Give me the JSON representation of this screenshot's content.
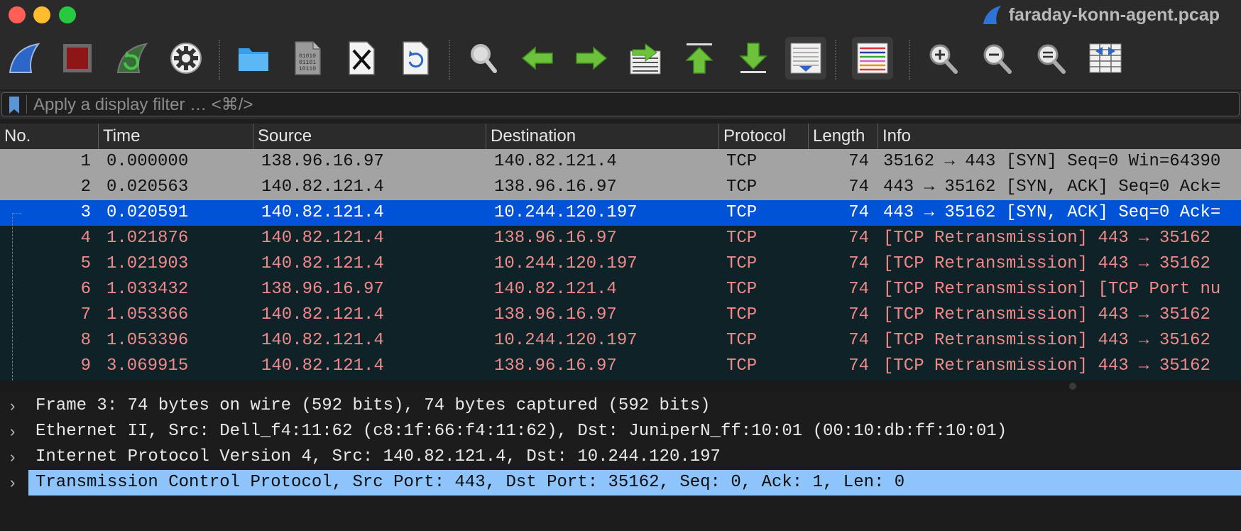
{
  "window": {
    "title": "faraday-konn-agent.pcap",
    "traffic_lights": {
      "close": "#ff5f57",
      "minimize": "#febc2e",
      "zoom": "#28c840"
    }
  },
  "toolbar": {
    "buttons": [
      {
        "name": "start-capture-button",
        "icon": "shark-fin-icon"
      },
      {
        "name": "stop-capture-button",
        "icon": "stop-square-icon"
      },
      {
        "name": "restart-capture-button",
        "icon": "restart-fin-icon"
      },
      {
        "name": "capture-options-button",
        "icon": "gear-icon"
      },
      {
        "name": "open-file-button",
        "icon": "folder-icon"
      },
      {
        "name": "save-file-button",
        "icon": "binary-file-icon"
      },
      {
        "name": "close-file-button",
        "icon": "close-file-icon"
      },
      {
        "name": "reload-file-button",
        "icon": "reload-file-icon"
      },
      {
        "name": "find-packet-button",
        "icon": "magnifier-icon"
      },
      {
        "name": "go-back-button",
        "icon": "arrow-left-icon"
      },
      {
        "name": "go-forward-button",
        "icon": "arrow-right-icon"
      },
      {
        "name": "go-to-packet-button",
        "icon": "goto-packet-icon"
      },
      {
        "name": "go-first-packet-button",
        "icon": "arrow-top-icon"
      },
      {
        "name": "go-last-packet-button",
        "icon": "arrow-bottom-icon"
      },
      {
        "name": "auto-scroll-button",
        "icon": "autoscroll-icon"
      },
      {
        "name": "colorize-button",
        "icon": "colorize-lines-icon"
      },
      {
        "name": "zoom-in-button",
        "icon": "zoom-in-icon"
      },
      {
        "name": "zoom-out-button",
        "icon": "zoom-out-icon"
      },
      {
        "name": "zoom-reset-button",
        "icon": "zoom-reset-icon"
      },
      {
        "name": "resize-columns-button",
        "icon": "resize-columns-icon"
      }
    ]
  },
  "filter": {
    "placeholder": "Apply a display filter … <⌘/>",
    "value": ""
  },
  "colors": {
    "selected_row_bg": "#0053d6",
    "gray_row_bg": "#a3a3a3",
    "dark_row_bg": "#0f2228",
    "error_text": "#f08a8a",
    "detail_selected_bg": "#8ec4fc"
  },
  "packet_list": {
    "columns": [
      "No.",
      "Time",
      "Source",
      "Destination",
      "Protocol",
      "Length",
      "Info"
    ],
    "rows": [
      {
        "no": "1",
        "time": "0.000000",
        "src": "138.96.16.97",
        "dst": "140.82.121.4",
        "proto": "TCP",
        "len": "74",
        "info": "35162 → 443 [SYN] Seq=0 Win=64390",
        "style": "gray"
      },
      {
        "no": "2",
        "time": "0.020563",
        "src": "140.82.121.4",
        "dst": "138.96.16.97",
        "proto": "TCP",
        "len": "74",
        "info": "443 → 35162 [SYN, ACK] Seq=0 Ack=",
        "style": "gray"
      },
      {
        "no": "3",
        "time": "0.020591",
        "src": "140.82.121.4",
        "dst": "10.244.120.197",
        "proto": "TCP",
        "len": "74",
        "info": "443 → 35162 [SYN, ACK] Seq=0 Ack=",
        "style": "selected"
      },
      {
        "no": "4",
        "time": "1.021876",
        "src": "140.82.121.4",
        "dst": "138.96.16.97",
        "proto": "TCP",
        "len": "74",
        "info": "[TCP Retransmission] 443 → 35162",
        "style": "error"
      },
      {
        "no": "5",
        "time": "1.021903",
        "src": "140.82.121.4",
        "dst": "10.244.120.197",
        "proto": "TCP",
        "len": "74",
        "info": "[TCP Retransmission] 443 → 35162",
        "style": "error"
      },
      {
        "no": "6",
        "time": "1.033432",
        "src": "138.96.16.97",
        "dst": "140.82.121.4",
        "proto": "TCP",
        "len": "74",
        "info": "[TCP Retransmission] [TCP Port nu",
        "style": "error"
      },
      {
        "no": "7",
        "time": "1.053366",
        "src": "140.82.121.4",
        "dst": "138.96.16.97",
        "proto": "TCP",
        "len": "74",
        "info": "[TCP Retransmission] 443 → 35162",
        "style": "error"
      },
      {
        "no": "8",
        "time": "1.053396",
        "src": "140.82.121.4",
        "dst": "10.244.120.197",
        "proto": "TCP",
        "len": "74",
        "info": "[TCP Retransmission] 443 → 35162",
        "style": "error"
      },
      {
        "no": "9",
        "time": "3.069915",
        "src": "140.82.121.4",
        "dst": "138.96.16.97",
        "proto": "TCP",
        "len": "74",
        "info": "[TCP Retransmission] 443 → 35162",
        "style": "error"
      }
    ]
  },
  "packet_details": [
    {
      "text": "Frame 3: 74 bytes on wire (592 bits), 74 bytes captured (592 bits)",
      "selected": false
    },
    {
      "text": "Ethernet II, Src: Dell_f4:11:62 (c8:1f:66:f4:11:62), Dst: JuniperN_ff:10:01 (00:10:db:ff:10:01)",
      "selected": false
    },
    {
      "text": "Internet Protocol Version 4, Src: 140.82.121.4, Dst: 10.244.120.197",
      "selected": false
    },
    {
      "text": "Transmission Control Protocol, Src Port: 443, Dst Port: 35162, Seq: 0, Ack: 1, Len: 0",
      "selected": true
    }
  ]
}
